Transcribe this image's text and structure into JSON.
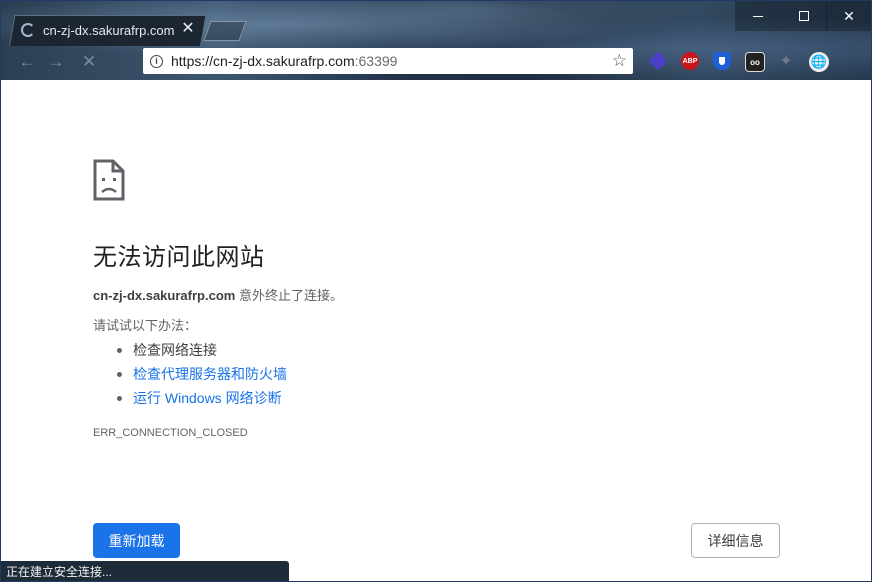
{
  "tab": {
    "title": "cn-zj-dx.sakurafrp.com",
    "close_symbol": "✕"
  },
  "toolbar": {
    "back_symbol": "←",
    "forward_symbol": "→",
    "stop_symbol": "✕"
  },
  "omnibox": {
    "url_main": "https://cn-zj-dx.sakurafrp.com",
    "url_port": ":63399",
    "star_symbol": "☆"
  },
  "extensions": [
    {
      "name": "gem-extension-icon"
    },
    {
      "name": "abp-icon",
      "label": "ABP"
    },
    {
      "name": "shield-extension-icon"
    },
    {
      "name": "camera-extension-icon"
    },
    {
      "name": "puzzle-icon"
    },
    {
      "name": "globe-profile-icon"
    }
  ],
  "window_controls": {
    "close_symbol": "✕"
  },
  "error_page": {
    "title": "无法访问此网站",
    "host": "cn-zj-dx.sakurafrp.com",
    "message_suffix": " 意外终止了连接。",
    "try_label": "请试试以下办法：",
    "suggestions": [
      {
        "text": "检查网络连接",
        "is_link": false
      },
      {
        "text": "检查代理服务器和防火墙",
        "is_link": true
      },
      {
        "text": "运行 Windows 网络诊断",
        "is_link": true
      }
    ],
    "error_code": "ERR_CONNECTION_CLOSED",
    "reload_label": "重新加载",
    "details_label": "详细信息"
  },
  "status_bar": {
    "text": "正在建立安全连接..."
  },
  "colors": {
    "primary_blue": "#1a73e8",
    "link_blue": "#1a73e8",
    "text_dark": "#202124",
    "text_muted": "#5f6368"
  }
}
